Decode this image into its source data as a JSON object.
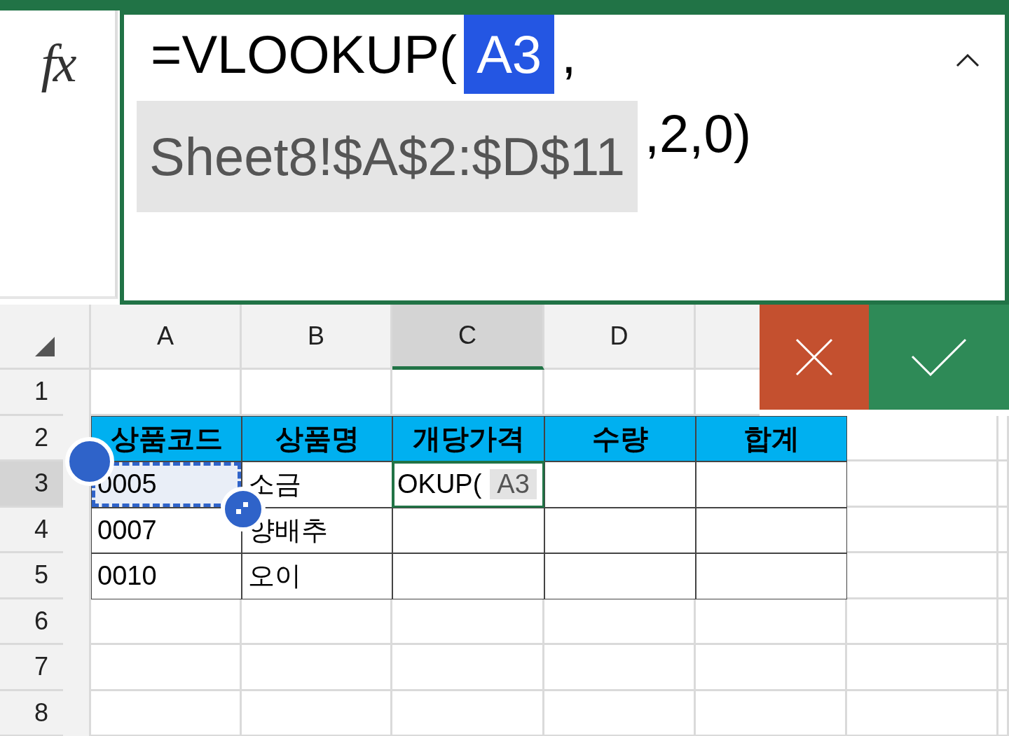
{
  "formula_bar": {
    "function_label": "fx",
    "expanded": true,
    "segments": [
      {
        "text": "=VLOOKUP(",
        "kind": "plain"
      },
      {
        "text": "A3",
        "kind": "active-ref"
      },
      {
        "text": ",",
        "kind": "plain"
      },
      {
        "text": "Sheet8!$A$2:$D$11",
        "kind": "ref"
      },
      {
        "text": ",2,0)",
        "kind": "plain"
      }
    ]
  },
  "sheet": {
    "columns": [
      {
        "label": "A",
        "selected": false
      },
      {
        "label": "B",
        "selected": false
      },
      {
        "label": "C",
        "selected": true
      },
      {
        "label": "D",
        "selected": false
      }
    ],
    "rows": [
      {
        "label": "1",
        "selected": false
      },
      {
        "label": "2",
        "selected": false
      },
      {
        "label": "3",
        "selected": true
      },
      {
        "label": "4",
        "selected": false
      },
      {
        "label": "5",
        "selected": false
      },
      {
        "label": "6",
        "selected": false
      },
      {
        "label": "7",
        "selected": false
      },
      {
        "label": "8",
        "selected": false
      }
    ],
    "table": {
      "header": [
        "상품코드",
        "상품명",
        "개당가격",
        "수량",
        "합계"
      ],
      "rows": [
        {
          "cells": [
            "0005",
            "소금"
          ],
          "referenced": true
        },
        {
          "cells": [
            "0007",
            "양배추"
          ],
          "referenced": false
        },
        {
          "cells": [
            "0010",
            "오이"
          ],
          "referenced": false
        }
      ]
    },
    "editing_cell": {
      "segments": [
        {
          "text": "OKUP(",
          "kind": "plain"
        },
        {
          "text": "A3",
          "kind": "ref"
        }
      ]
    }
  }
}
